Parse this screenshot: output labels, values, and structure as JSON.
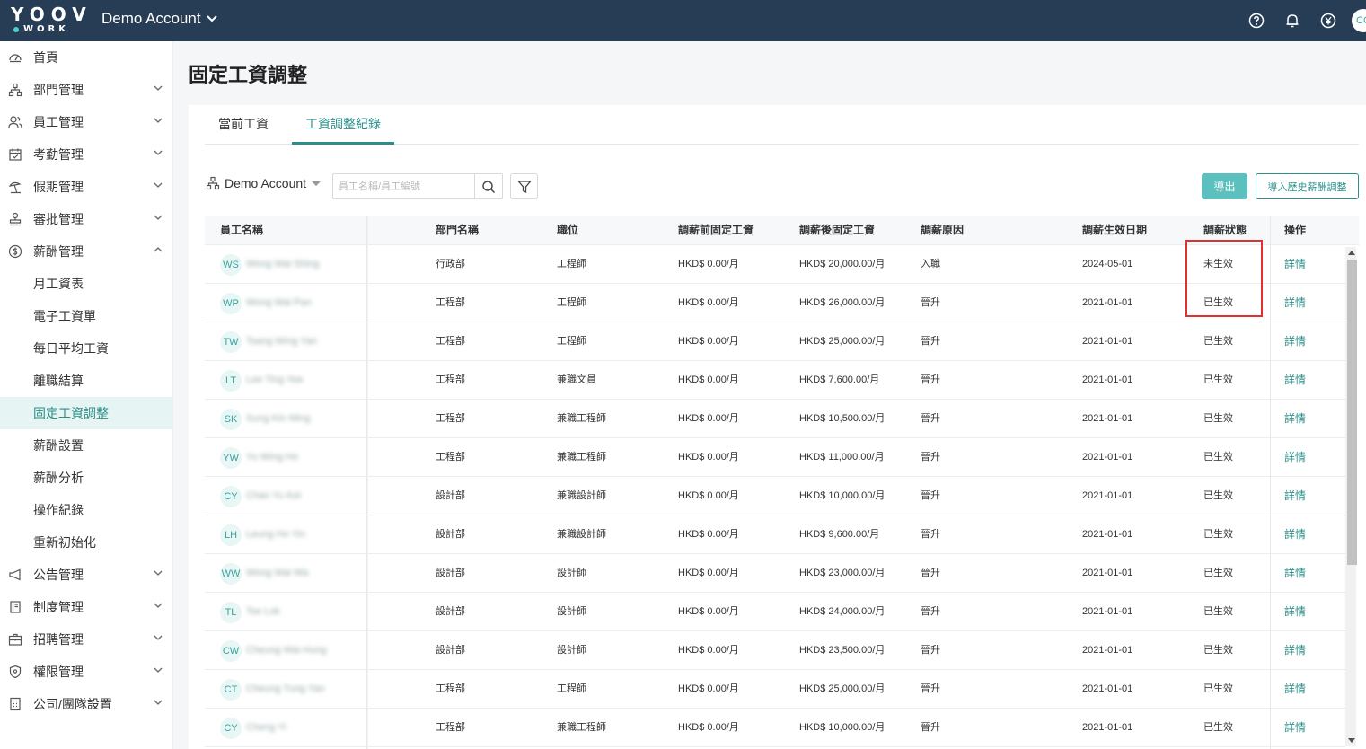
{
  "topbar": {
    "logo_top": "YOOV",
    "logo_bottom": "WORK",
    "account_name": "Demo Account",
    "avatar_initials": "CC",
    "icons": [
      "help-icon",
      "bell-icon",
      "currency-icon"
    ]
  },
  "sidebar": {
    "items": [
      {
        "label": "首頁",
        "icon": "dashboard-icon",
        "expandable": false
      },
      {
        "label": "部門管理",
        "icon": "org-chart-icon",
        "expandable": true
      },
      {
        "label": "員工管理",
        "icon": "users-icon",
        "expandable": true
      },
      {
        "label": "考勤管理",
        "icon": "calendar-check-icon",
        "expandable": true
      },
      {
        "label": "假期管理",
        "icon": "vacation-icon",
        "expandable": true
      },
      {
        "label": "審批管理",
        "icon": "stamp-icon",
        "expandable": true
      },
      {
        "label": "薪酬管理",
        "icon": "dollar-icon",
        "expandable": true,
        "expanded": true
      }
    ],
    "payroll_sub": [
      {
        "label": "月工資表"
      },
      {
        "label": "電子工資單"
      },
      {
        "label": "每日平均工資"
      },
      {
        "label": "離職結算"
      },
      {
        "label": "固定工資調整",
        "active": true
      },
      {
        "label": "薪酬設置"
      },
      {
        "label": "薪酬分析"
      },
      {
        "label": "操作紀錄"
      },
      {
        "label": "重新初始化"
      }
    ],
    "items_after": [
      {
        "label": "公告管理",
        "icon": "megaphone-icon"
      },
      {
        "label": "制度管理",
        "icon": "book-icon"
      },
      {
        "label": "招聘管理",
        "icon": "briefcase-icon"
      },
      {
        "label": "權限管理",
        "icon": "shield-icon"
      },
      {
        "label": "公司/團隊設置",
        "icon": "building-icon"
      }
    ]
  },
  "page": {
    "title": "固定工資調整",
    "tabs": [
      "當前工資",
      "工資調整紀錄"
    ],
    "active_tab": 1
  },
  "toolbar": {
    "dept_filter": "Demo Account",
    "search_placeholder": "員工名稱/員工編號",
    "export_label": "導出",
    "import_label": "導入歷史薪酬調整"
  },
  "table": {
    "headers": [
      "員工名稱",
      "部門名稱",
      "職位",
      "調薪前固定工資",
      "調薪後固定工資",
      "調薪原因",
      "調薪生效日期",
      "調薪狀態",
      "操作"
    ],
    "rows": [
      {
        "initials": "WS",
        "name": "Wong Wai Shing",
        "dept": "行政部",
        "position": "工程師",
        "before": "HKD$ 0.00/月",
        "after": "HKD$ 20,000.00/月",
        "reason": "入職",
        "date": "2024-05-01",
        "status": "未生效",
        "action": "詳情"
      },
      {
        "initials": "WP",
        "name": "Wong Wai Pan",
        "dept": "工程部",
        "position": "工程師",
        "before": "HKD$ 0.00/月",
        "after": "HKD$ 26,000.00/月",
        "reason": "晉升",
        "date": "2021-01-01",
        "status": "已生效",
        "action": "詳情"
      },
      {
        "initials": "TW",
        "name": "Tsang Wing Yan",
        "dept": "工程部",
        "position": "工程師",
        "before": "HKD$ 0.00/月",
        "after": "HKD$ 25,000.00/月",
        "reason": "晉升",
        "date": "2021-01-01",
        "status": "已生效",
        "action": "詳情"
      },
      {
        "initials": "LT",
        "name": "Lee Ting Yee",
        "dept": "工程部",
        "position": "兼職文員",
        "before": "HKD$ 0.00/月",
        "after": "HKD$ 7,600.00/月",
        "reason": "晉升",
        "date": "2021-01-01",
        "status": "已生效",
        "action": "詳情"
      },
      {
        "initials": "SK",
        "name": "Sung Kin Ming",
        "dept": "工程部",
        "position": "兼職工程師",
        "before": "HKD$ 0.00/月",
        "after": "HKD$ 10,500.00/月",
        "reason": "晉升",
        "date": "2021-01-01",
        "status": "已生效",
        "action": "詳情"
      },
      {
        "initials": "YW",
        "name": "Yu Wing Ho",
        "dept": "工程部",
        "position": "兼職工程師",
        "before": "HKD$ 0.00/月",
        "after": "HKD$ 11,000.00/月",
        "reason": "晉升",
        "date": "2021-01-01",
        "status": "已生效",
        "action": "詳情"
      },
      {
        "initials": "CY",
        "name": "Chan Yu Kei",
        "dept": "設計部",
        "position": "兼職設計師",
        "before": "HKD$ 0.00/月",
        "after": "HKD$ 10,000.00/月",
        "reason": "晉升",
        "date": "2021-01-01",
        "status": "已生效",
        "action": "詳情"
      },
      {
        "initials": "LH",
        "name": "Leung Ho Yin",
        "dept": "設計部",
        "position": "兼職設計師",
        "before": "HKD$ 0.00/月",
        "after": "HKD$ 9,600.00/月",
        "reason": "晉升",
        "date": "2021-01-01",
        "status": "已生效",
        "action": "詳情"
      },
      {
        "initials": "WW",
        "name": "Wong Wai Wa",
        "dept": "設計部",
        "position": "設計師",
        "before": "HKD$ 0.00/月",
        "after": "HKD$ 23,000.00/月",
        "reason": "晉升",
        "date": "2021-01-01",
        "status": "已生效",
        "action": "詳情"
      },
      {
        "initials": "TL",
        "name": "Tse Lok",
        "dept": "設計部",
        "position": "設計師",
        "before": "HKD$ 0.00/月",
        "after": "HKD$ 24,000.00/月",
        "reason": "晉升",
        "date": "2021-01-01",
        "status": "已生效",
        "action": "詳情"
      },
      {
        "initials": "CW",
        "name": "Cheung Wai Hung",
        "dept": "設計部",
        "position": "設計師",
        "before": "HKD$ 0.00/月",
        "after": "HKD$ 23,500.00/月",
        "reason": "晉升",
        "date": "2021-01-01",
        "status": "已生效",
        "action": "詳情"
      },
      {
        "initials": "CT",
        "name": "Cheung Tung Yan",
        "dept": "工程部",
        "position": "工程師",
        "before": "HKD$ 0.00/月",
        "after": "HKD$ 25,000.00/月",
        "reason": "晉升",
        "date": "2021-01-01",
        "status": "已生效",
        "action": "詳情"
      },
      {
        "initials": "CY",
        "name": "Cheng Yi",
        "dept": "工程部",
        "position": "兼職工程師",
        "before": "HKD$ 0.00/月",
        "after": "HKD$ 10,000.00/月",
        "reason": "晉升",
        "date": "2021-01-01",
        "status": "已生效",
        "action": "詳情"
      }
    ]
  },
  "colors": {
    "topbar_bg": "#273c55",
    "accent": "#2a8f88",
    "export_bg": "#5bc0be",
    "highlight": "#e03030"
  }
}
